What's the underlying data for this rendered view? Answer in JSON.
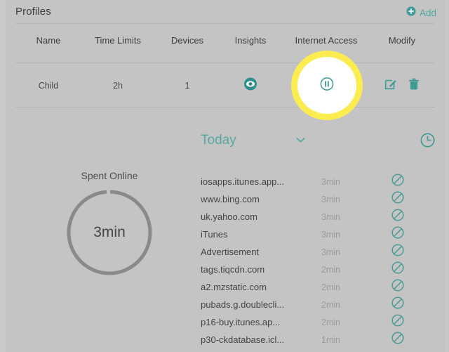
{
  "theme": {
    "background": "#c4c4c4",
    "accent_teal": "#3f9a96",
    "accent_teal_light": "#56a8a3",
    "highlight_yellow": "#fbec4f",
    "divider": "#b4b4b4",
    "muted_text": "#9b9b9b",
    "donut_ring": "#8a8a8a"
  },
  "header": {
    "title": "Profiles",
    "add_label": "Add",
    "add_icon": "plus-circle-icon"
  },
  "table": {
    "columns": [
      "Name",
      "Time Limits",
      "Devices",
      "Insights",
      "Internet Access",
      "Modify"
    ],
    "rows": [
      {
        "name": "Child",
        "time_limits": "2h",
        "devices": "1",
        "insights_icon": "eye-icon",
        "internet_access_icon": "pause-icon",
        "modify_icons": [
          "edit-icon",
          "delete-icon"
        ],
        "highlighted_cell": "internet-access"
      }
    ]
  },
  "insights_panel": {
    "period_label": "Today",
    "period_caret_icon": "chevron-down-icon",
    "history_icon": "clock-icon",
    "spent_online": {
      "title": "Spent Online",
      "value": "3min",
      "ring_fraction": 0.985
    },
    "sites": [
      {
        "name": "iosapps.itunes.app...",
        "time": "3min",
        "block_icon": "block-icon"
      },
      {
        "name": "www.bing.com",
        "time": "3min",
        "block_icon": "block-icon"
      },
      {
        "name": "uk.yahoo.com",
        "time": "3min",
        "block_icon": "block-icon"
      },
      {
        "name": "iTunes",
        "time": "3min",
        "block_icon": "block-icon"
      },
      {
        "name": "Advertisement",
        "time": "3min",
        "block_icon": "block-icon"
      },
      {
        "name": "tags.tiqcdn.com",
        "time": "2min",
        "block_icon": "block-icon"
      },
      {
        "name": "a2.mzstatic.com",
        "time": "2min",
        "block_icon": "block-icon"
      },
      {
        "name": "pubads.g.doublecli...",
        "time": "2min",
        "block_icon": "block-icon"
      },
      {
        "name": "p16-buy.itunes.ap...",
        "time": "2min",
        "block_icon": "block-icon"
      },
      {
        "name": "p30-ckdatabase.icl...",
        "time": "1min",
        "block_icon": "block-icon"
      }
    ]
  }
}
